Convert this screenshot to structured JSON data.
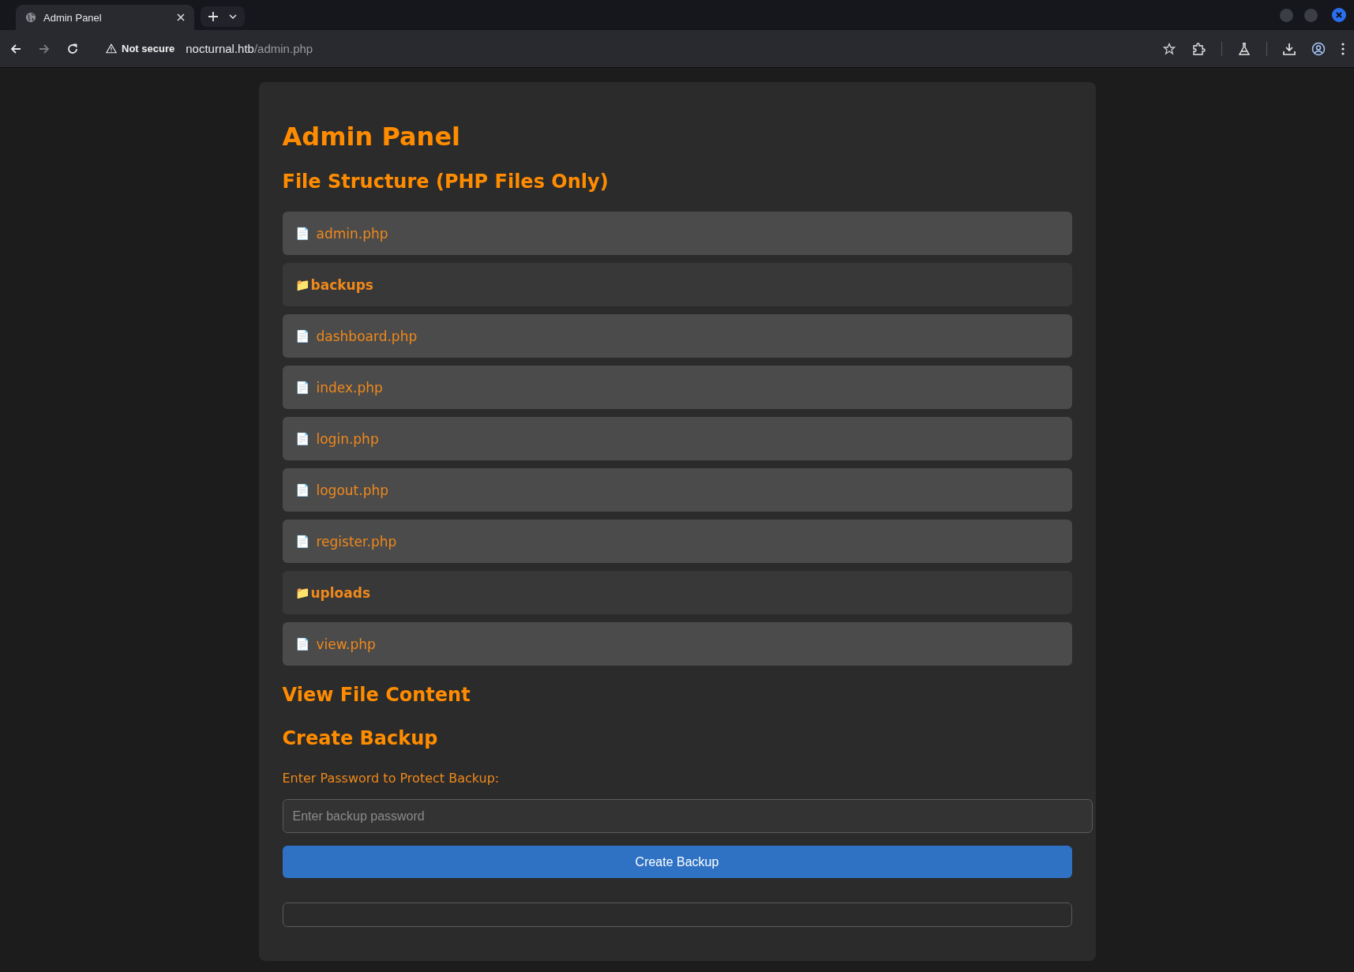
{
  "browser": {
    "tab": {
      "title": "Admin Panel",
      "selected": true
    },
    "security": "Not secure",
    "url_host": "nocturnal.htb",
    "url_path": "/admin.php"
  },
  "page": {
    "title": "Admin Panel",
    "file_section_title": "File Structure (PHP Files Only)",
    "items": [
      {
        "kind": "file",
        "icon": "📄",
        "name": "admin.php"
      },
      {
        "kind": "folder",
        "icon": "📁",
        "name": "backups"
      },
      {
        "kind": "file",
        "icon": "📄",
        "name": "dashboard.php"
      },
      {
        "kind": "file",
        "icon": "📄",
        "name": "index.php"
      },
      {
        "kind": "file",
        "icon": "📄",
        "name": "login.php"
      },
      {
        "kind": "file",
        "icon": "📄",
        "name": "logout.php"
      },
      {
        "kind": "file",
        "icon": "📄",
        "name": "register.php"
      },
      {
        "kind": "folder",
        "icon": "📁",
        "name": "uploads"
      },
      {
        "kind": "file",
        "icon": "📄",
        "name": "view.php"
      }
    ],
    "view_section_title": "View File Content",
    "backup_section_title": "Create Backup",
    "password_label": "Enter Password to Protect Backup:",
    "password_field": {
      "placeholder": "Enter backup password"
    },
    "backup_button": "Create Backup"
  }
}
